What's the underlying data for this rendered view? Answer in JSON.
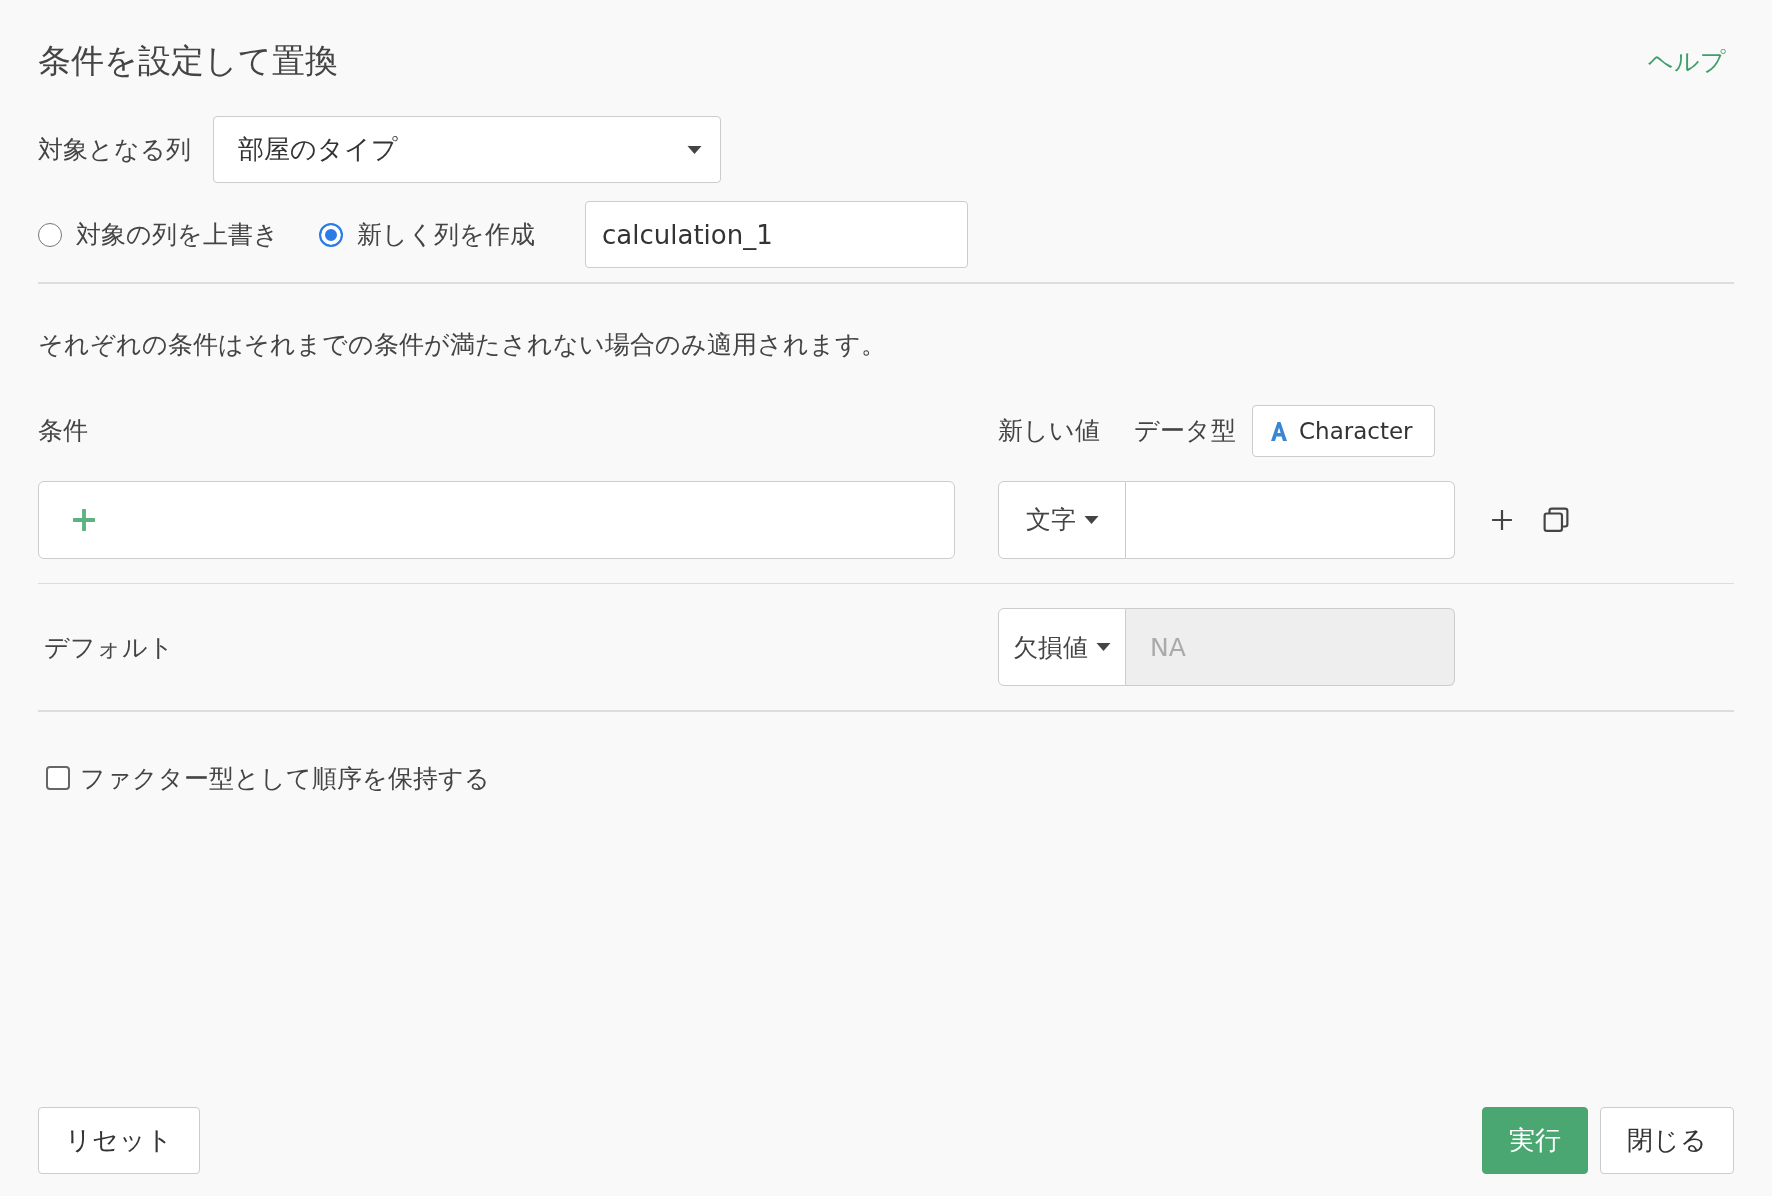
{
  "dialog": {
    "title": "条件を設定して置換",
    "help_link": "ヘルプ"
  },
  "target_column": {
    "label": "対象となる列",
    "value": "部屋のタイプ"
  },
  "output_mode": {
    "options": [
      {
        "label": "対象の列を上書き",
        "selected": false
      },
      {
        "label": "新しく列を作成",
        "selected": true
      }
    ],
    "new_column_name": "calculation_1"
  },
  "note": "それぞれの条件はそれまでの条件が満たされない場合のみ適用されます。",
  "conditions": {
    "header": "条件",
    "new_value_header": "新しい値",
    "data_type_label": "データ型",
    "data_type": "Character",
    "rows": [
      {
        "value_type": "文字",
        "value": ""
      }
    ]
  },
  "default": {
    "label": "デフォルト",
    "value_type": "欠損値",
    "placeholder": "NA",
    "disabled": true
  },
  "keep_factor_order": {
    "label": "ファクター型として順序を保持する",
    "checked": false
  },
  "buttons": {
    "reset": "リセット",
    "run": "実行",
    "close": "閉じる"
  }
}
